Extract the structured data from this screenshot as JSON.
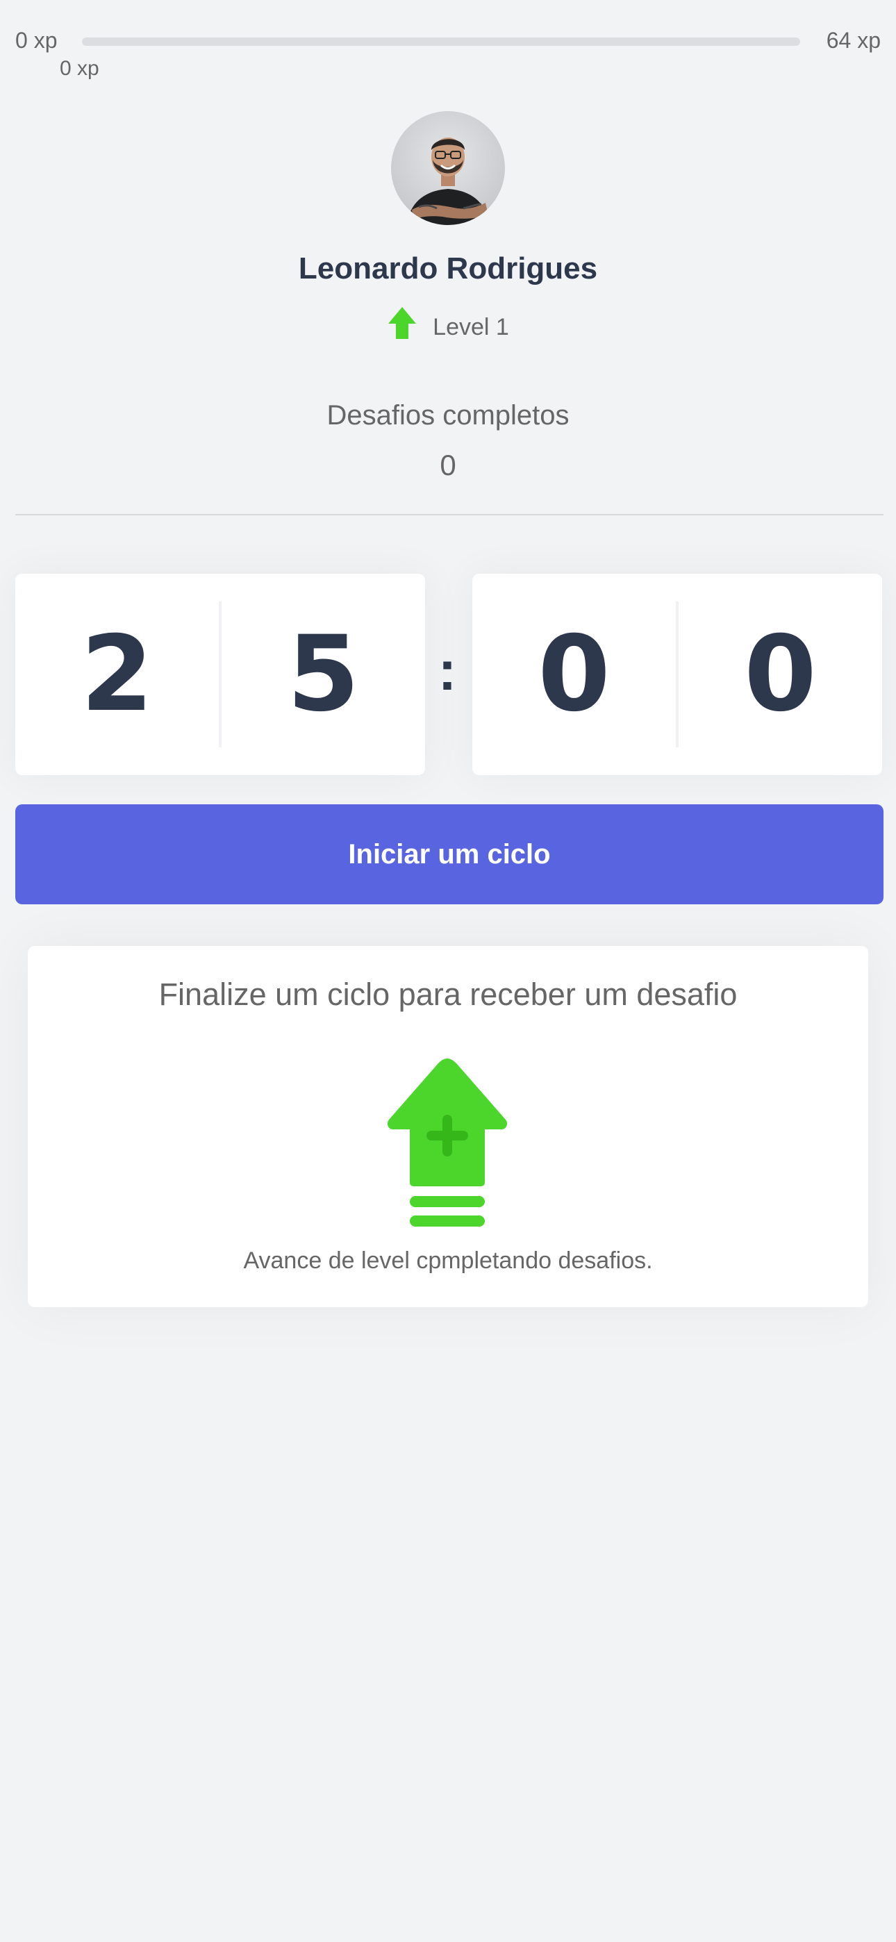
{
  "experience": {
    "min_label": "0 xp",
    "max_label": "64 xp",
    "current_label": "0 xp",
    "progress_percent": 0
  },
  "profile": {
    "name": "Leonardo Rodrigues",
    "level_label": "Level 1",
    "level_icon": "level-up-arrow-icon"
  },
  "challenges": {
    "label": "Desafios completos",
    "count": "0"
  },
  "countdown": {
    "minute_left": "2",
    "minute_right": "5",
    "separator": ":",
    "second_left": "0",
    "second_right": "0"
  },
  "start_button": {
    "label": "Iniciar um ciclo"
  },
  "challenge_box": {
    "title": "Finalize um ciclo para receber um desafio",
    "icon": "level-up-icon",
    "hint": "Avance de level cpmpletando desafios."
  },
  "colors": {
    "accent": "#5965e0",
    "level_green": "#4cd62b",
    "title_text": "#2e384d",
    "body_text": "#666666",
    "background": "#f2f3f5"
  }
}
